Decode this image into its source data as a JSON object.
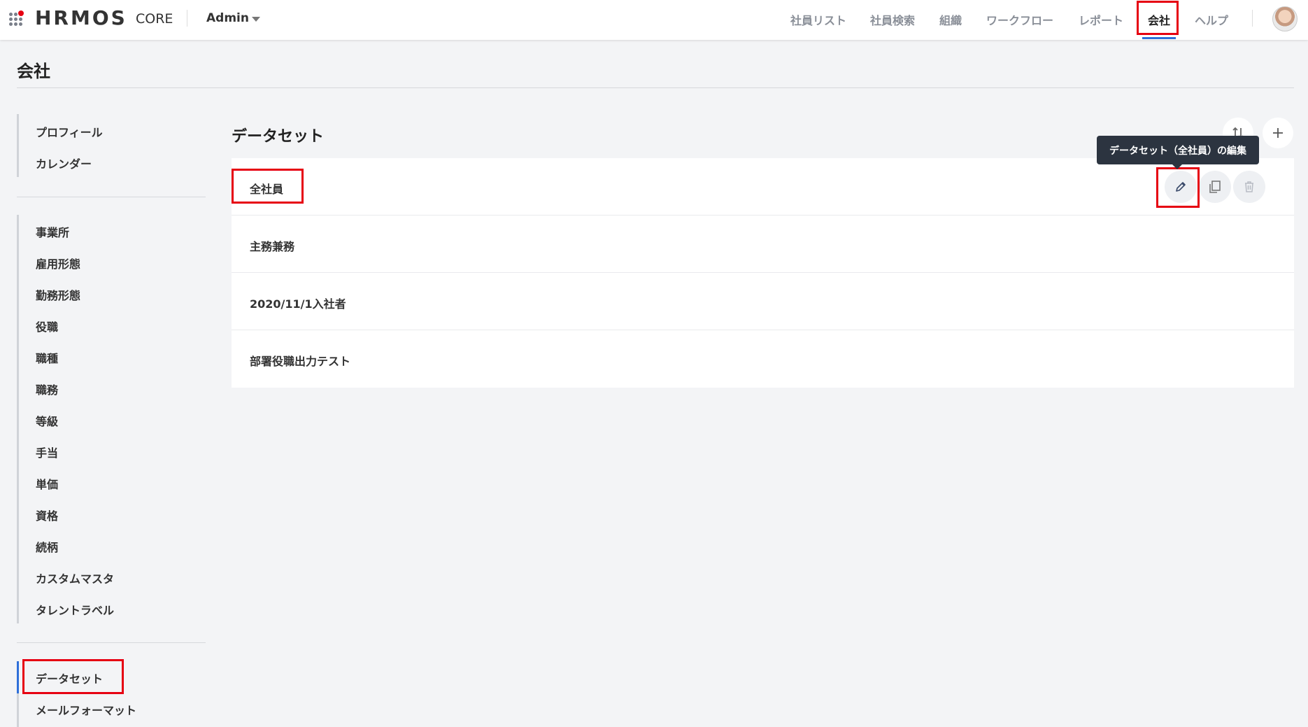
{
  "header": {
    "logo": "HRMOS",
    "product": "CORE",
    "account_label": "Admin",
    "nav": [
      "社員リスト",
      "社員検索",
      "組織",
      "ワークフロー",
      "レポート",
      "会社",
      "ヘルプ"
    ],
    "active_nav": "会社"
  },
  "page": {
    "title": "会社"
  },
  "sidebar": {
    "group1": [
      "プロフィール",
      "カレンダー"
    ],
    "group2": [
      "事業所",
      "雇用形態",
      "勤務形態",
      "役職",
      "職種",
      "職務",
      "等級",
      "手当",
      "単価",
      "資格",
      "続柄",
      "カスタムマスタ",
      "タレントラベル"
    ],
    "group3": [
      "データセット",
      "メールフォーマット"
    ],
    "active_item": "データセット"
  },
  "main": {
    "section_title": "データセット",
    "tooltip": "データセット（全社員）の編集",
    "rows": [
      "全社員",
      "主務兼務",
      "2020/11/1入社者",
      "部署役職出力テスト"
    ]
  },
  "colors": {
    "accent": "#2e6fd9",
    "highlight": "#e60012",
    "tooltip_bg": "#2c3440"
  }
}
